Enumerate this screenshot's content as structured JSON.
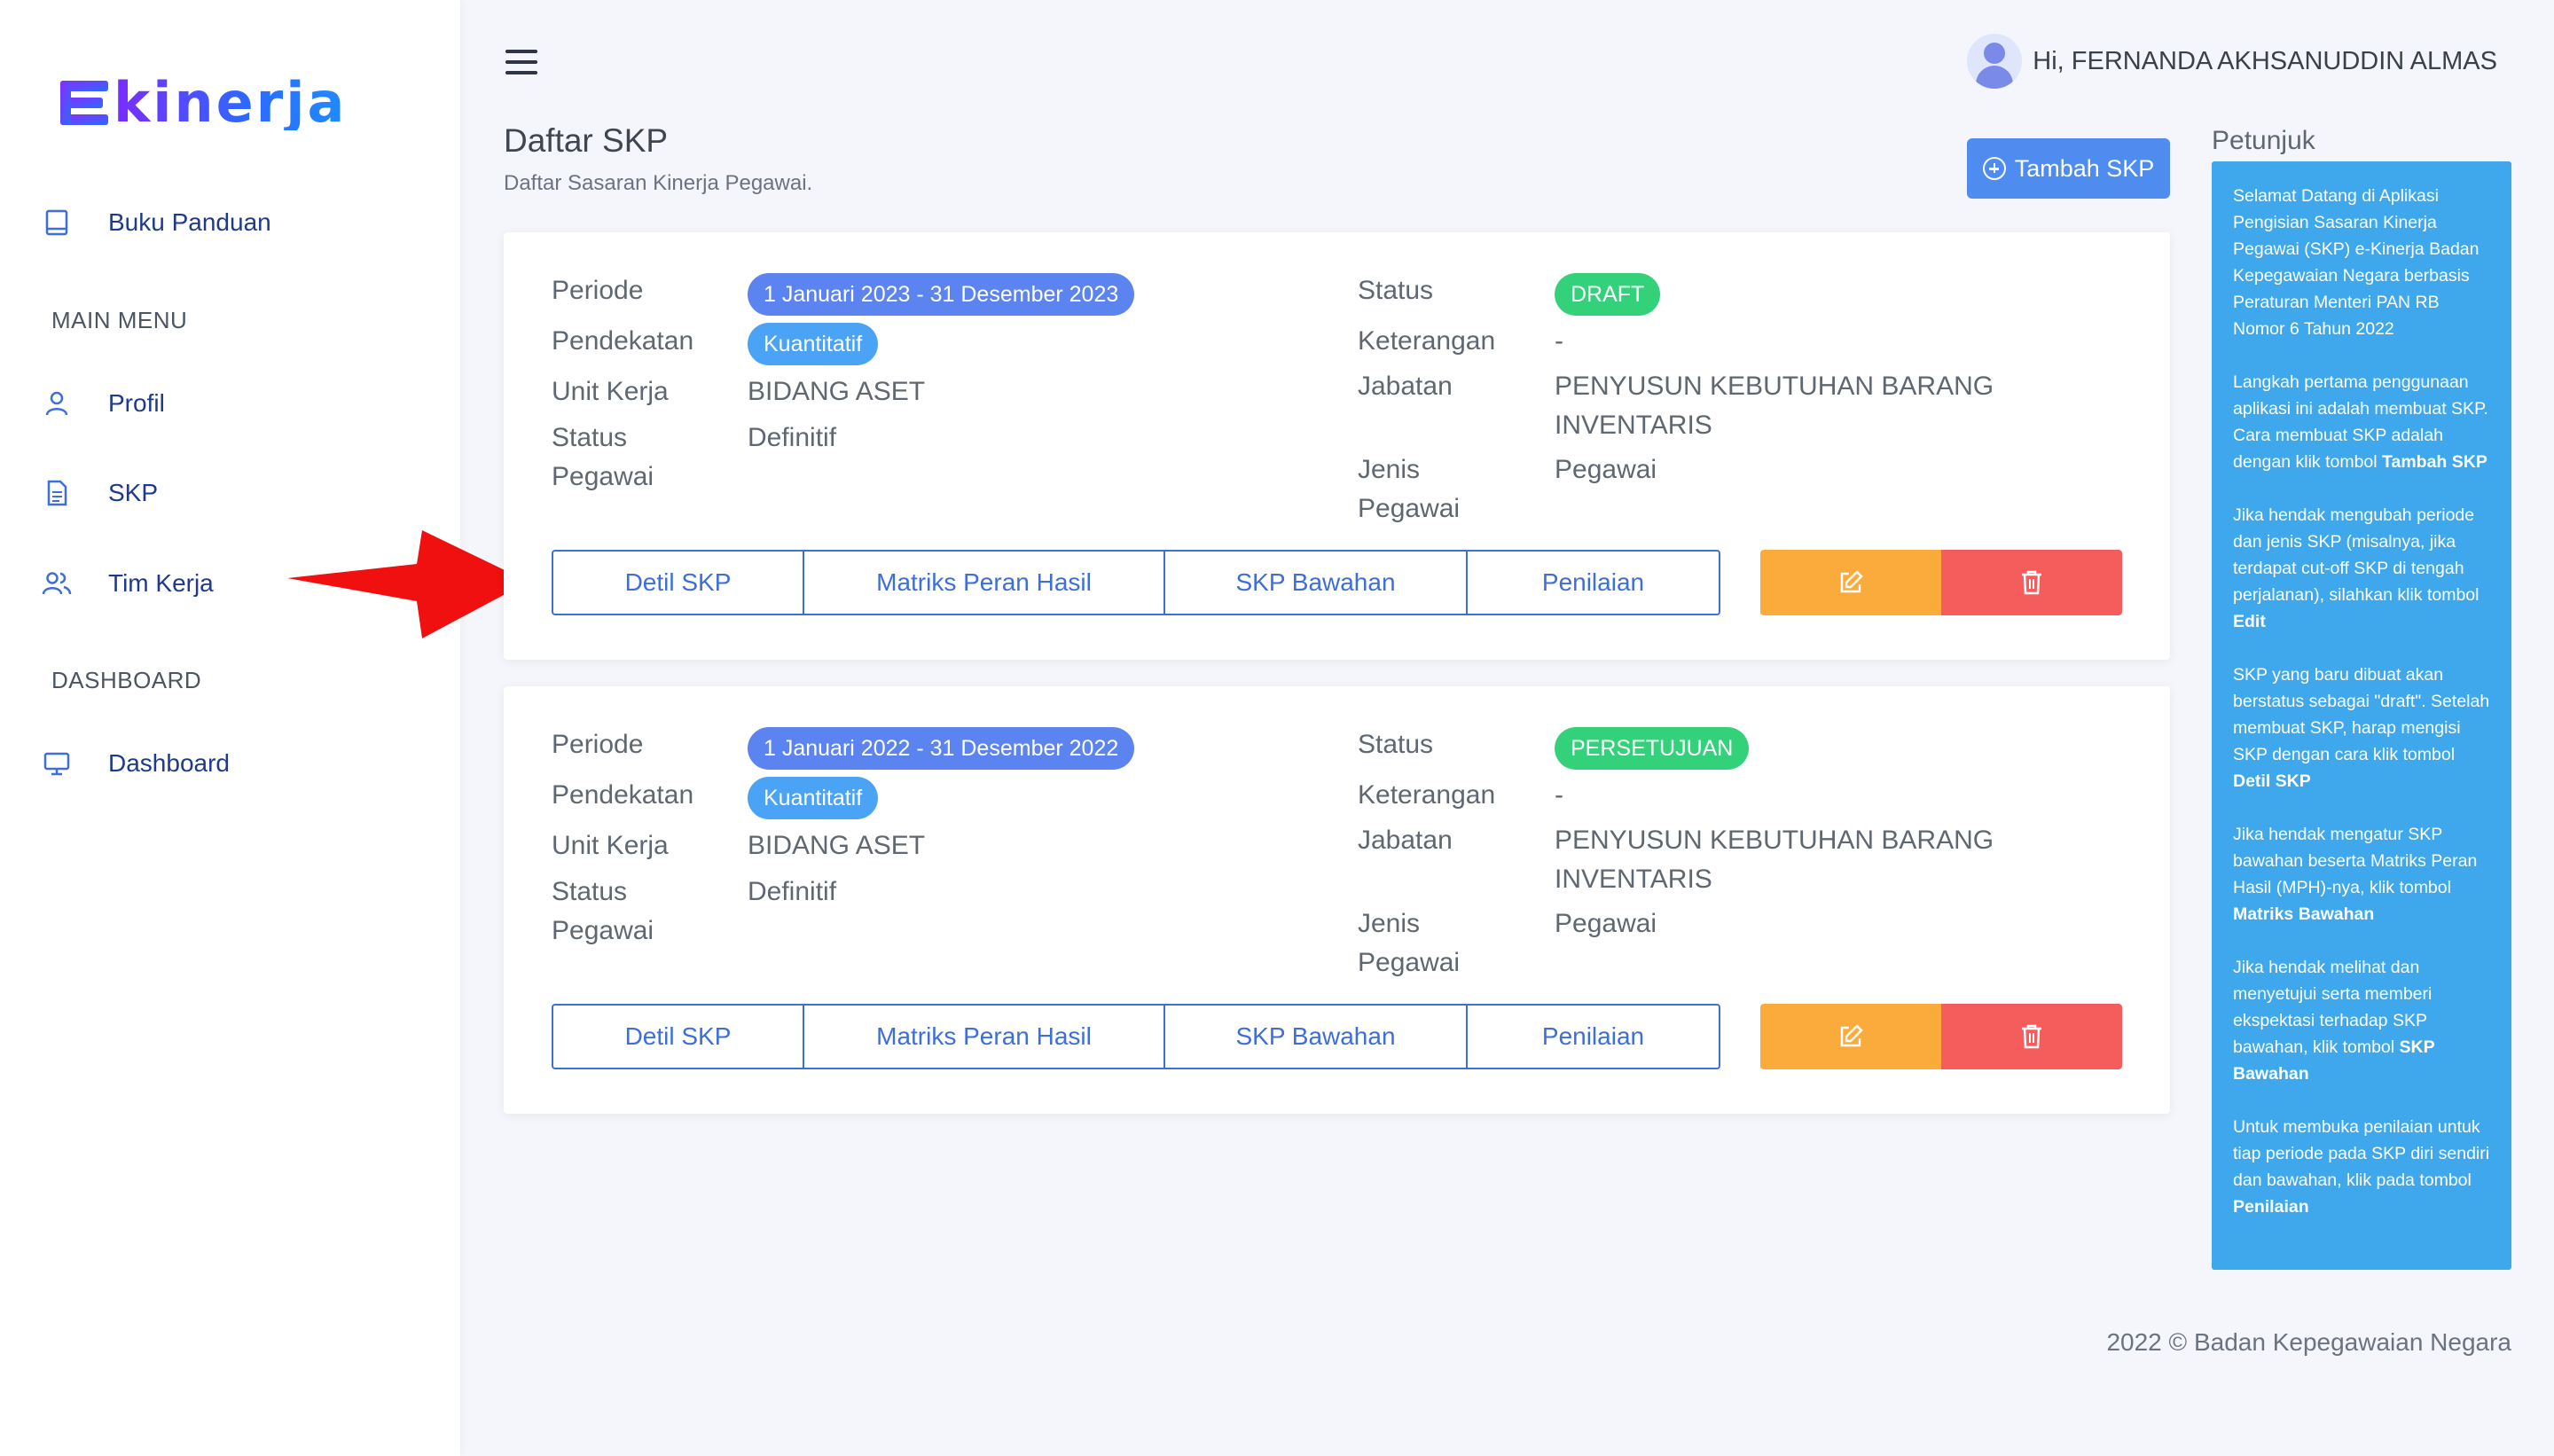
{
  "app": {
    "logo_text": "kinerja",
    "user_greeting": "Hi, FERNANDA AKHSANUDDIN ALMAS"
  },
  "sidebar": {
    "buku_panduan": "Buku Panduan",
    "main_menu_label": "MAIN MENU",
    "profil": "Profil",
    "skp": "SKP",
    "tim_kerja": "Tim Kerja",
    "dashboard_label": "DASHBOARD",
    "dashboard": "Dashboard"
  },
  "page": {
    "title": "Daftar SKP",
    "subtitle": "Daftar Sasaran Kinerja Pegawai.",
    "add_button": "Tambah SKP"
  },
  "labels": {
    "periode": "Periode",
    "pendekatan": "Pendekatan",
    "unit_kerja": "Unit Kerja",
    "status_pegawai_1": "Status",
    "status_pegawai_2": "Pegawai",
    "status": "Status",
    "keterangan": "Keterangan",
    "jabatan": "Jabatan",
    "jenis_pegawai_1": "Jenis",
    "jenis_pegawai_2": "Pegawai"
  },
  "actions": {
    "detil": "Detil SKP",
    "matriks": "Matriks Peran Hasil",
    "bawahan": "SKP Bawahan",
    "penilaian": "Penilaian"
  },
  "cards": [
    {
      "periode": "1 Januari 2023 - 31 Desember 2023",
      "pendekatan": "Kuantitatif",
      "unit_kerja": "BIDANG ASET",
      "status_pegawai": "Definitif",
      "status": "DRAFT",
      "keterangan": "-",
      "jabatan_1": "PENYUSUN KEBUTUHAN BARANG",
      "jabatan_2": "INVENTARIS",
      "jenis_pegawai": "Pegawai"
    },
    {
      "periode": "1 Januari 2022 - 31 Desember 2022",
      "pendekatan": "Kuantitatif",
      "unit_kerja": "BIDANG ASET",
      "status_pegawai": "Definitif",
      "status": "PERSETUJUAN",
      "keterangan": "-",
      "jabatan_1": "PENYUSUN KEBUTUHAN BARANG",
      "jabatan_2": "INVENTARIS",
      "jenis_pegawai": "Pegawai"
    }
  ],
  "petunjuk": {
    "title": "Petunjuk",
    "p1": "Selamat Datang di Aplikasi Pengisian Sasaran Kinerja Pegawai (SKP) e-Kinerja Badan Kepegawaian Negara berbasis Peraturan Menteri PAN RB Nomor 6 Tahun 2022",
    "p2_text": "Langkah pertama penggunaan aplikasi ini adalah membuat SKP. Cara membuat SKP adalah dengan klik tombol ",
    "p2_bold": "Tambah SKP",
    "p3_text": "Jika hendak mengubah periode dan jenis SKP (misalnya, jika terdapat cut-off SKP di tengah perjalanan), silahkan klik tombol ",
    "p3_bold": "Edit",
    "p4_text": "SKP yang baru dibuat akan berstatus sebagai \"draft\". Setelah membuat SKP, harap mengisi SKP dengan cara klik tombol ",
    "p4_bold": "Detil SKP",
    "p5_text": "Jika hendak mengatur SKP bawahan beserta Matriks Peran Hasil (MPH)-nya, klik tombol ",
    "p5_bold": "Matriks Bawahan",
    "p6_text": "Jika hendak melihat dan menyetujui serta memberi ekspektasi terhadap SKP bawahan, klik tombol ",
    "p6_bold": "SKP Bawahan",
    "p7_text": "Untuk membuka penilaian untuk tiap periode pada SKP diri sendiri dan bawahan, klik pada tombol ",
    "p7_bold": "Penilaian"
  },
  "footer": "2022 © Badan Kepegawaian Negara",
  "colors": {
    "primary": "#4f8cf0",
    "edit": "#fbab3c",
    "delete": "#f55d5d",
    "status_green": "#34d17b",
    "petunjuk_bg": "#3fa8ec",
    "annotation_arrow": "#f01010"
  }
}
